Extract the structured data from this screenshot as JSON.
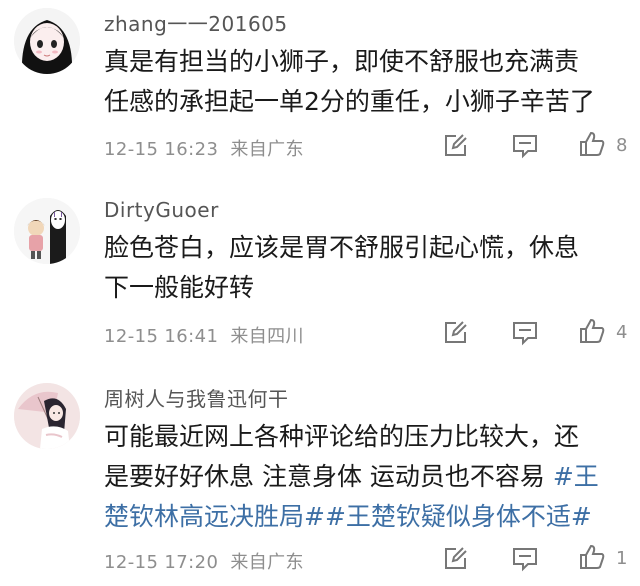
{
  "comments": [
    {
      "username": "zhang一一201605",
      "lines": [
        "真是有担当的小狮子，即使不舒服也充满责",
        "任感的承担起一单2分的重任，小狮子辛苦了"
      ],
      "time": "12-15 16:23",
      "location": "来自广东",
      "likes": "8"
    },
    {
      "username": "DirtyGuoer",
      "lines": [
        "脸色苍白，应该是胃不舒服引起心慌，休息",
        "下一般能好转"
      ],
      "time": "12-15 16:41",
      "location": "来自四川",
      "likes": "4"
    },
    {
      "username": "周树人与我鲁迅何干",
      "line1": "可能最近网上各种评论给的压力比较大，还",
      "line2_text": "是要好好休息 注意身体 运动员也不容易 ",
      "line2_tag": "#王",
      "line3": "楚钦林高远决胜局##王楚钦疑似身体不适#",
      "time": "12-15 17:20",
      "location": "来自广东",
      "likes": "1"
    }
  ],
  "icons": [
    "avatar-girl",
    "avatar-noface",
    "avatar-umbrella-girl",
    "edit-icon",
    "comment-icon",
    "thumbs-up-icon"
  ],
  "colors": {
    "hashtag": "#3d6fa5",
    "meta": "#8e8e8e",
    "text": "#1a1a1a"
  }
}
